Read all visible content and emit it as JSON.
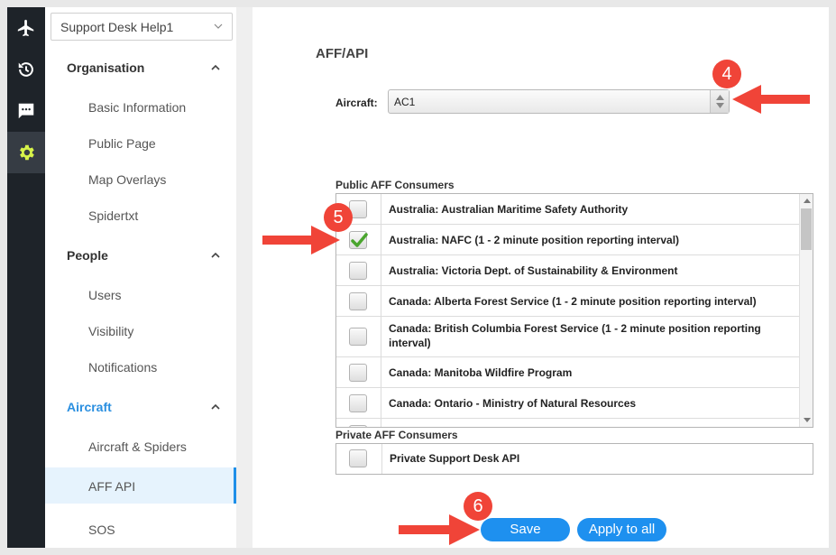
{
  "sidebar": {
    "account_select": "Support Desk Help1",
    "sections": [
      {
        "label": "Organisation",
        "items": [
          "Basic Information",
          "Public Page",
          "Map Overlays",
          "Spidertxt"
        ]
      },
      {
        "label": "People",
        "items": [
          "Users",
          "Visibility",
          "Notifications"
        ]
      },
      {
        "label": "Aircraft",
        "items": [
          "Aircraft & Spiders",
          "AFF API",
          "SOS"
        ]
      }
    ],
    "active_item": "AFF API"
  },
  "rail": {
    "icons": [
      "airplane-icon",
      "history-icon",
      "chat-icon",
      "gear-icon"
    ],
    "active_icon": "gear-icon",
    "active_color": "#d7f34a"
  },
  "main": {
    "title": "AFF/API",
    "aircraft_label": "Aircraft:",
    "aircraft_value": "AC1",
    "public_label": "Public AFF Consumers",
    "public_consumers": [
      {
        "name": "Australia: Australian Maritime Safety Authority",
        "checked": false
      },
      {
        "name": "Australia: NAFC (1 - 2 minute position reporting interval)",
        "checked": true
      },
      {
        "name": "Australia: Victoria Dept. of Sustainability & Environment",
        "checked": false
      },
      {
        "name": "Canada: Alberta Forest Service (1 - 2 minute position reporting interval)",
        "checked": false
      },
      {
        "name": "Canada: British Columbia Forest Service (1 - 2 minute position reporting interval)",
        "checked": false
      },
      {
        "name": "Canada: Manitoba Wildfire Program",
        "checked": false
      },
      {
        "name": "Canada: Ontario - Ministry of Natural Resources",
        "checked": false
      }
    ],
    "private_label": "Private AFF Consumers",
    "private_consumers": [
      {
        "name": "Private Support Desk API",
        "checked": false
      }
    ],
    "save_label": "Save",
    "apply_all_label": "Apply to all"
  },
  "annotations": {
    "step_4": "4",
    "step_5": "5",
    "step_6": "6",
    "color": "#f04438"
  }
}
